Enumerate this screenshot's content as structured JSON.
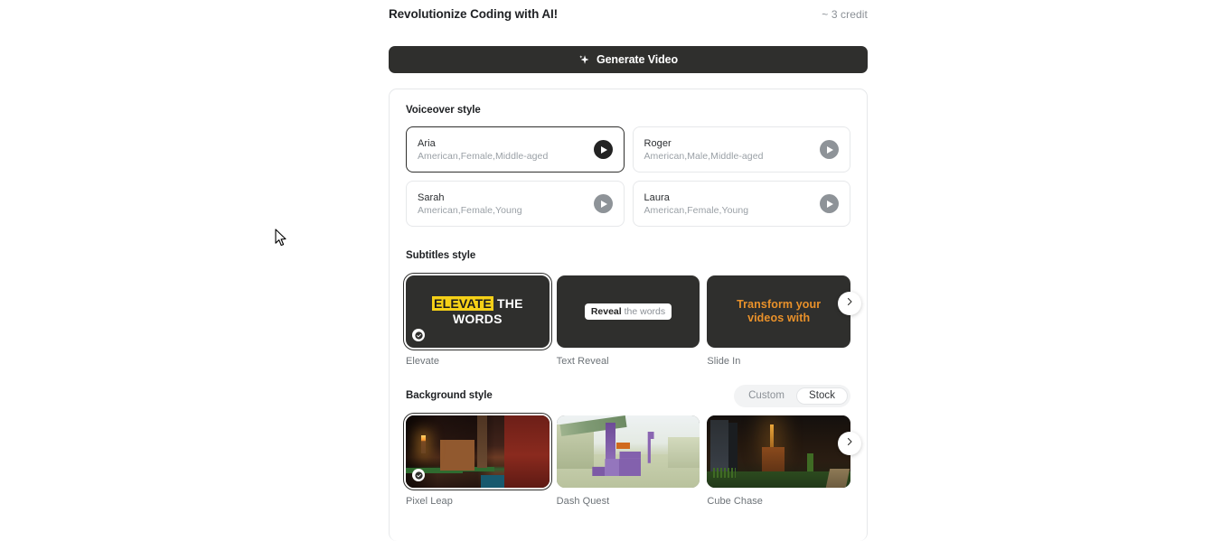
{
  "header": {
    "title": "Revolutionize Coding with AI!",
    "credit": "~ 3 credit"
  },
  "generate": {
    "label": "Generate Video",
    "icon": "sparkle-icon"
  },
  "voiceover": {
    "label": "Voiceover style",
    "options": [
      {
        "name": "Aria",
        "meta": "American,Female,Middle-aged",
        "selected": true
      },
      {
        "name": "Roger",
        "meta": "American,Male,Middle-aged",
        "selected": false
      },
      {
        "name": "Sarah",
        "meta": "American,Female,Young",
        "selected": false
      },
      {
        "name": "Laura",
        "meta": "American,Female,Young",
        "selected": false
      }
    ]
  },
  "subtitles": {
    "label": "Subtitles style",
    "options": [
      {
        "caption": "Elevate",
        "selected": true,
        "preview_highlight": "ELEVATE",
        "preview_rest": " THE WORDS"
      },
      {
        "caption": "Text Reveal",
        "selected": false,
        "preview_bold": "Reveal",
        "preview_dim": " the words"
      },
      {
        "caption": "Slide In",
        "selected": false,
        "preview_line1": "Transform your",
        "preview_line2": "videos with"
      }
    ],
    "next_icon": "chevron-right-icon"
  },
  "background": {
    "label": "Background style",
    "toggle": {
      "custom": "Custom",
      "stock": "Stock",
      "active": "Stock"
    },
    "options": [
      {
        "caption": "Pixel Leap",
        "selected": true
      },
      {
        "caption": "Dash Quest",
        "selected": false
      },
      {
        "caption": "Cube Chase",
        "selected": false
      }
    ],
    "next_icon": "chevron-right-icon"
  },
  "colors": {
    "accent_dark": "#2f2f2d",
    "highlight_yellow": "#f5d017",
    "slide_orange": "#e9912a",
    "muted_text": "#9aa0a6",
    "border": "#e6e8ea"
  }
}
